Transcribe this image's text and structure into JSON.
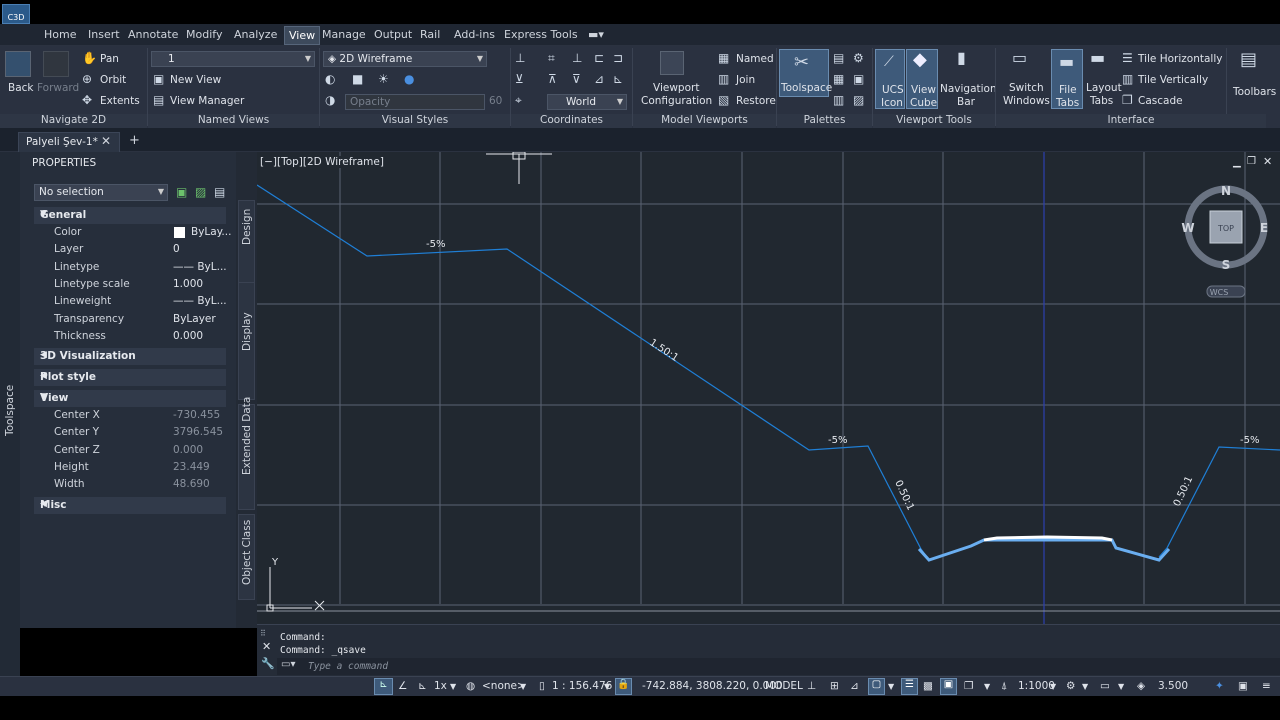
{
  "menu": {
    "items": [
      "Home",
      "Insert",
      "Annotate",
      "Modify",
      "Analyze",
      "View",
      "Manage",
      "Output",
      "Rail",
      "Add-ins",
      "Express Tools"
    ],
    "active": "View"
  },
  "ribbon": {
    "navigate2d": {
      "title": "Navigate 2D",
      "back": "Back",
      "forward": "Forward",
      "pan": "Pan",
      "orbit": "Orbit",
      "extents": "Extents"
    },
    "named_views": {
      "title": "Named Views",
      "combo_value": "1",
      "new_view": "New View",
      "view_manager": "View Manager"
    },
    "visual_styles": {
      "title": "Visual Styles",
      "combo_value": "2D Wireframe",
      "opacity_label": "Opacity",
      "opacity_value": "60"
    },
    "coordinates": {
      "title": "Coordinates",
      "ucs_value": "World"
    },
    "model_viewports": {
      "title": "Model Viewports",
      "viewport_config_line1": "Viewport",
      "viewport_config_line2": "Configuration",
      "named": "Named",
      "join": "Join",
      "restore": "Restore"
    },
    "palettes": {
      "title": "Palettes",
      "toolspace": "Toolspace"
    },
    "viewport_tools": {
      "title": "Viewport Tools",
      "ucs_icon_line1": "UCS",
      "ucs_icon_line2": "Icon",
      "view_cube_line1": "View",
      "view_cube_line2": "Cube",
      "nav_bar_line1": "Navigation",
      "nav_bar_line2": "Bar"
    },
    "interface": {
      "title": "Interface",
      "switch_line1": "Switch",
      "switch_line2": "Windows",
      "file_tabs_line1": "File",
      "file_tabs_line2": "Tabs",
      "layout_tabs_line1": "Layout",
      "layout_tabs_line2": "Tabs",
      "tile_h": "Tile Horizontally",
      "tile_v": "Tile Vertically",
      "cascade": "Cascade",
      "toolbars": "Toolbars"
    }
  },
  "file_tab": {
    "name": "Palyeli Şev-1*"
  },
  "properties": {
    "title": "PROPERTIES",
    "selection": "No selection",
    "general": {
      "header": "General",
      "rows": [
        {
          "k": "Color",
          "v": "ByLay..."
        },
        {
          "k": "Layer",
          "v": "0"
        },
        {
          "k": "Linetype",
          "v": "—— ByL..."
        },
        {
          "k": "Linetype scale",
          "v": "1.000"
        },
        {
          "k": "Lineweight",
          "v": "—— ByL..."
        },
        {
          "k": "Transparency",
          "v": "ByLayer"
        },
        {
          "k": "Thickness",
          "v": "0.000"
        }
      ]
    },
    "viz3d": "3D Visualization",
    "plot_style": "Plot style",
    "view": {
      "header": "View",
      "rows": [
        {
          "k": "Center X",
          "v": "-730.455"
        },
        {
          "k": "Center Y",
          "v": "3796.545"
        },
        {
          "k": "Center Z",
          "v": "0.000"
        },
        {
          "k": "Height",
          "v": "23.449"
        },
        {
          "k": "Width",
          "v": "48.690"
        }
      ]
    },
    "misc": "Misc"
  },
  "palette_tabs": [
    "Design",
    "Display",
    "Extended Data",
    "Object Class"
  ],
  "toolspace_label": "Toolspace",
  "viewport": {
    "label": "[−][Top][2D Wireframe]",
    "annotations": [
      "-5%",
      "1.50:1",
      "-5%",
      "0.50:1",
      "0.50:1",
      "-5%"
    ],
    "compass": {
      "n": "N",
      "s": "S",
      "e": "E",
      "w": "W",
      "top": "TOP",
      "wcs": "WCS"
    },
    "ucs_y": "Y",
    "colors": {
      "line": "#1f7fd6",
      "grid": "#5a6373",
      "bg": "#212830",
      "accent": "#6aaef0"
    }
  },
  "command": {
    "history": [
      "Command:",
      "Command: _qsave"
    ],
    "placeholder": "Type a command"
  },
  "status": {
    "coords": "-742.884, 3808.220, 0.000",
    "model": "MODEL",
    "scale_ratio": "1 : 156.476",
    "annot_scale": "1:1000",
    "lineweight": "3.500",
    "none": "<none>",
    "one_x": "1x"
  }
}
